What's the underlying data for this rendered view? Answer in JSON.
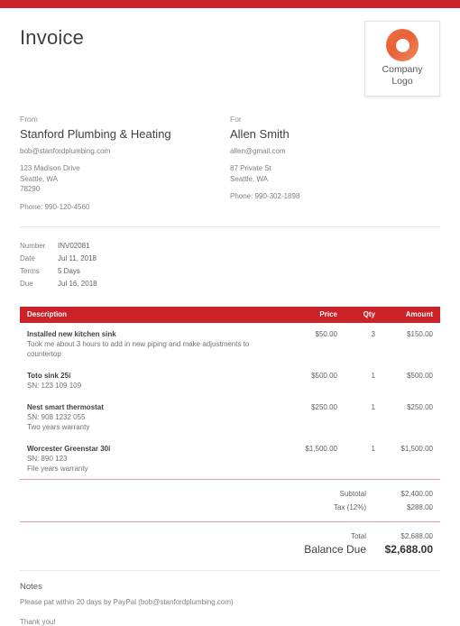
{
  "document": {
    "title": "Invoice",
    "accent_color": "#cb2128",
    "rule_color": "#dfa0a4"
  },
  "logo": {
    "icon": "ring-logo-icon",
    "caption_line1": "Company",
    "caption_line2": "Logo"
  },
  "from": {
    "label": "From",
    "name": "Stanford Plumbing & Heating",
    "email": "bob@stanfordplumbing.com",
    "address": [
      "123 Madison Drive",
      "Seattle, WA",
      "78290"
    ],
    "phone": "Phone: 990-120-4560"
  },
  "for": {
    "label": "For",
    "name": "Allen Smith",
    "email": "allen@gmail.com",
    "address": [
      "87 Private St",
      "Seattle, WA"
    ],
    "phone": "Phone: 990-302-1898"
  },
  "meta": [
    {
      "key": "Number",
      "value": "INV02081"
    },
    {
      "key": "Date",
      "value": "Jul 11, 2018"
    },
    {
      "key": "Terms",
      "value": "5 Days"
    },
    {
      "key": "Due",
      "value": "Jul 16, 2018"
    }
  ],
  "table": {
    "headers": {
      "description": "Description",
      "price": "Price",
      "qty": "Qty",
      "amount": "Amount"
    },
    "rows": [
      {
        "name": "Installed new kitchen sink",
        "sub1": "Took me about 3 hours to add in new piping and make adjustments to countertop",
        "sub2": "",
        "price": "$50.00",
        "qty": "3",
        "amount": "$150.00"
      },
      {
        "name": "Toto sink 25i",
        "sub1": "SN: 123 109 109",
        "sub2": "",
        "price": "$500.00",
        "qty": "1",
        "amount": "$500.00"
      },
      {
        "name": "Nest smart thermostat",
        "sub1": "SN: 908 1232 055",
        "sub2": "Two years warranty",
        "price": "$250.00",
        "qty": "1",
        "amount": "$250.00"
      },
      {
        "name": "Worcester Greenstar 30i",
        "sub1": "SN: 890 123",
        "sub2": "File years warranty",
        "price": "$1,500.00",
        "qty": "1",
        "amount": "$1,500.00"
      }
    ]
  },
  "totals": {
    "subtotal_label": "Subtotal",
    "subtotal_value": "$2,400.00",
    "tax_label": "Tax (12%)",
    "tax_value": "$288.00",
    "total_label": "Total",
    "total_value": "$2,688.00",
    "balance_label": "Balance Due",
    "balance_value": "$2,688.00"
  },
  "notes": {
    "title": "Notes",
    "line1": "Please pat within 20 days by PayPal (bob@stanfordplumbing.com)",
    "thanks": "Thank you!"
  }
}
